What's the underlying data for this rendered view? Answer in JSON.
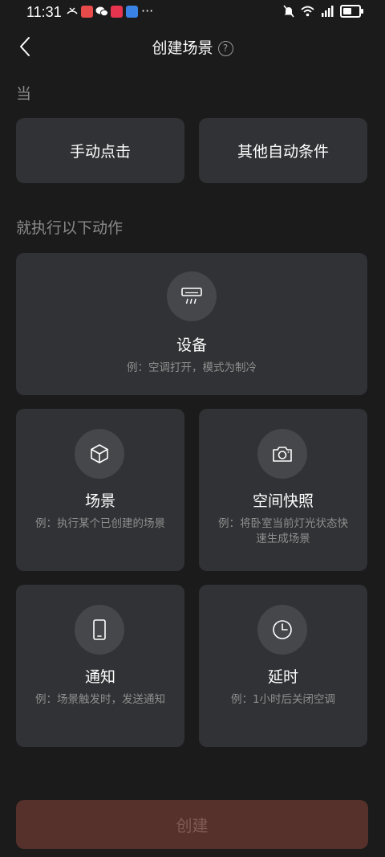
{
  "status_bar": {
    "time": "11:31",
    "dots": "···"
  },
  "header": {
    "title": "创建场景",
    "help": "?"
  },
  "when_section": {
    "label": "当",
    "options": [
      {
        "label": "手动点击"
      },
      {
        "label": "其他自动条件"
      }
    ]
  },
  "action_section": {
    "label": "就执行以下动作",
    "device": {
      "title": "设备",
      "desc": "例：空调打开，模式为制冷",
      "icon": "air-conditioner-icon"
    },
    "scene": {
      "title": "场景",
      "desc": "例：执行某个已创建的场景",
      "icon": "cube-icon"
    },
    "snapshot": {
      "title": "空间快照",
      "desc": "例：将卧室当前灯光状态快速生成场景",
      "icon": "camera-icon"
    },
    "notify": {
      "title": "通知",
      "desc": "例：场景触发时，发送通知",
      "icon": "phone-icon"
    },
    "delay": {
      "title": "延时",
      "desc": "例：1小时后关闭空调",
      "icon": "clock-icon"
    }
  },
  "create_button": {
    "label": "创建"
  },
  "colors": {
    "background": "#1b1b1c",
    "card": "#313235",
    "create_button": "#56302a"
  }
}
